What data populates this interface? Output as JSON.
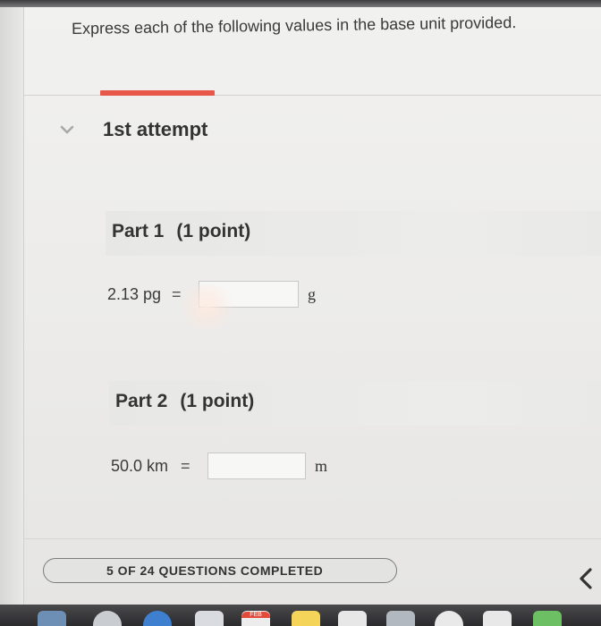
{
  "question": {
    "prompt": "Express each of the following values in the base unit provided."
  },
  "attempt": {
    "label": "1st attempt",
    "chevron_icon": "chevron-down-icon"
  },
  "parts": [
    {
      "title": "Part 1",
      "points": "(1 point)",
      "quantity": "2.13 pg",
      "equals": "=",
      "answer_value": "",
      "unit": "g"
    },
    {
      "title": "Part 2",
      "points": "(1 point)",
      "quantity": "50.0 km",
      "equals": "=",
      "answer_value": "",
      "unit": "m"
    }
  ],
  "progress": {
    "text": "5 OF 24 QUESTIONS COMPLETED",
    "completed": 5,
    "total": 24,
    "prev_icon": "chevron-left-icon"
  },
  "dock": {
    "calendar_badge": "FEB"
  },
  "colors": {
    "accent": "#e8584a",
    "text": "#333333",
    "page_background": "#ecebe9"
  }
}
